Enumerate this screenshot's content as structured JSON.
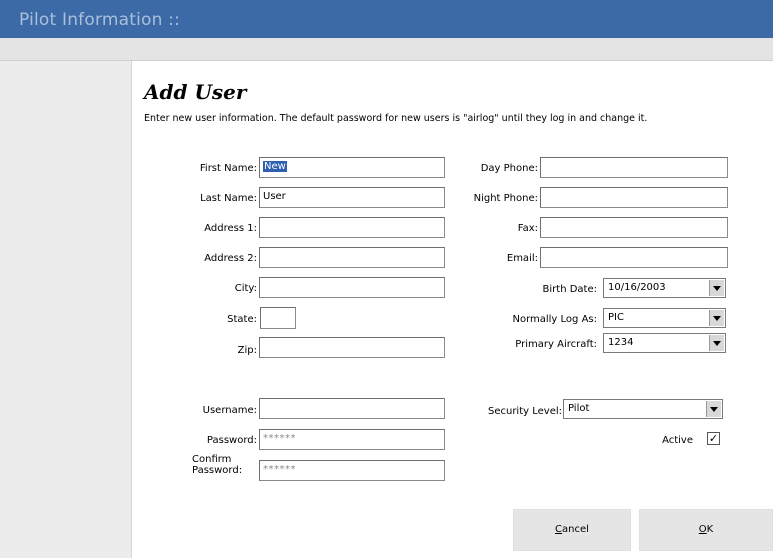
{
  "window": {
    "title": "Pilot Information ::"
  },
  "form": {
    "heading": "Add User",
    "intro": "Enter new user information.  The default password for new users is \"airlog\" until they log in and change it.",
    "left": {
      "first_name": {
        "label": "First Name:",
        "value": "New"
      },
      "last_name": {
        "label": "Last Name:",
        "value": "User"
      },
      "address1": {
        "label": "Address 1:",
        "value": ""
      },
      "address2": {
        "label": "Address 2:",
        "value": ""
      },
      "city": {
        "label": "City:",
        "value": ""
      },
      "state": {
        "label": "State:",
        "value": ""
      },
      "zip": {
        "label": "Zip:",
        "value": ""
      }
    },
    "right": {
      "day_phone": {
        "label": "Day Phone:",
        "value": ""
      },
      "night_phone": {
        "label": "Night Phone:",
        "value": ""
      },
      "fax": {
        "label": "Fax:",
        "value": ""
      },
      "email": {
        "label": "Email:",
        "value": ""
      },
      "birth_date": {
        "label": "Birth Date:",
        "value": "10/16/2003"
      },
      "normally_log_as": {
        "label": "Normally Log As:",
        "value": "PIC"
      },
      "primary_aircraft": {
        "label": "Primary Aircraft:",
        "value": "1234"
      }
    },
    "account": {
      "username": {
        "label": "Username:",
        "value": ""
      },
      "password": {
        "label": "Password:",
        "value": "******"
      },
      "confirm_password": {
        "label_line1": "Confirm",
        "label_line2": "Password:",
        "value": "******"
      },
      "security_level": {
        "label": "Security Level:",
        "value": "Pilot"
      },
      "active": {
        "label": "Active",
        "checked": true,
        "mark": "✓"
      }
    }
  },
  "buttons": {
    "cancel_rest": "ancel",
    "cancel_accel": "C",
    "ok_rest": "K",
    "ok_accel": "O"
  },
  "colors": {
    "titlebar": "#3c6aa7",
    "title_text": "#a9bfdc",
    "selection": "#2f5fb0"
  }
}
